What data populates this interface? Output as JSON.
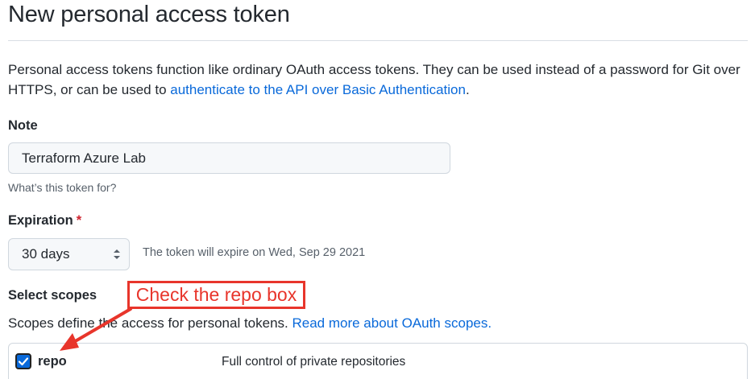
{
  "page": {
    "title": "New personal access token",
    "intro_text": "Personal access tokens function like ordinary OAuth access tokens. They can be used instead of a password for Git over HTTPS, or can be used to ",
    "intro_link": "authenticate to the API over Basic Authentication",
    "intro_end": "."
  },
  "note": {
    "label": "Note",
    "value": "Terraform Azure Lab",
    "hint": "What’s this token for?"
  },
  "expiration": {
    "label": "Expiration",
    "required_mark": "*",
    "selected": "30 days",
    "info": "The token will expire on Wed, Sep 29 2021"
  },
  "scopes": {
    "label": "Select scopes",
    "desc": "Scopes define the access for personal tokens. ",
    "desc_link": "Read more about OAuth scopes.",
    "items": [
      {
        "name": "repo",
        "description": "Full control of private repositories",
        "checked": true
      }
    ]
  },
  "annotation": {
    "callout_text": "Check the repo box",
    "color": "#e8352b"
  },
  "colors": {
    "link": "#0969da",
    "required": "#cf222e",
    "checkbox": "#0969da"
  }
}
